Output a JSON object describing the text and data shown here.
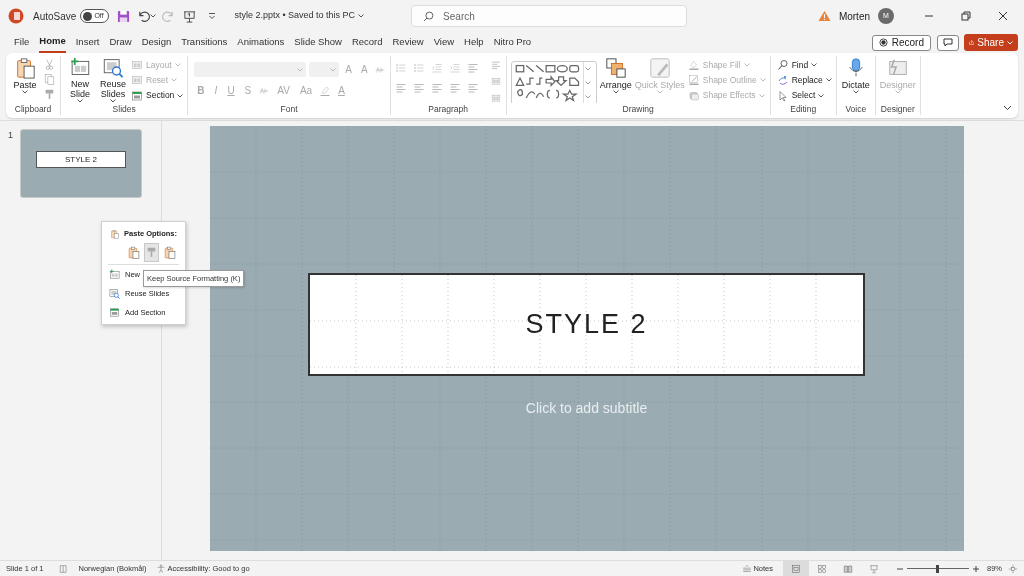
{
  "title_bar": {
    "autosave_label": "AutoSave",
    "autosave": {
      "on": false,
      "label": "Off"
    },
    "document_title": "style 2.pptx • Saved to this PC",
    "search": {
      "placeholder": "Search"
    },
    "user_name": "Morten",
    "avatar_initial": "M"
  },
  "tabs": [
    {
      "label": "File",
      "selected": false
    },
    {
      "label": "Home",
      "selected": true
    },
    {
      "label": "Insert",
      "selected": false
    },
    {
      "label": "Draw",
      "selected": false
    },
    {
      "label": "Design",
      "selected": false
    },
    {
      "label": "Transitions",
      "selected": false
    },
    {
      "label": "Animations",
      "selected": false
    },
    {
      "label": "Slide Show",
      "selected": false
    },
    {
      "label": "Record",
      "selected": false
    },
    {
      "label": "Review",
      "selected": false
    },
    {
      "label": "View",
      "selected": false
    },
    {
      "label": "Help",
      "selected": false
    },
    {
      "label": "Nitro Pro",
      "selected": false
    }
  ],
  "record_button": "Record",
  "share_button": "Share",
  "ribbon": {
    "groups": [
      {
        "title": "Clipboard",
        "items": [
          {
            "kind": "large",
            "label": "Paste",
            "disabled": false
          }
        ]
      },
      {
        "title": "Slides",
        "items": [
          {
            "kind": "large",
            "label": "New Slide",
            "disabled": false
          },
          {
            "kind": "large",
            "label": "Reuse Slides",
            "disabled": false
          },
          {
            "kind": "small",
            "label": "Layout",
            "disabled": true
          },
          {
            "kind": "small",
            "label": "Reset",
            "disabled": true
          },
          {
            "kind": "small",
            "label": "Section",
            "disabled": false
          }
        ]
      },
      {
        "title": "Font",
        "items": [
          {
            "kind": "text",
            "label": "A",
            "disabled": true
          },
          {
            "kind": "text",
            "label": "A",
            "disabled": true
          },
          {
            "kind": "text",
            "label": "B",
            "disabled": true
          },
          {
            "kind": "text",
            "label": "I",
            "disabled": true
          },
          {
            "kind": "text",
            "label": "U",
            "disabled": true
          },
          {
            "kind": "text",
            "label": "S",
            "disabled": true
          },
          {
            "kind": "text",
            "label": "AV",
            "disabled": true
          },
          {
            "kind": "text",
            "label": "Aa",
            "disabled": true
          },
          {
            "kind": "text",
            "label": "A",
            "disabled": true
          }
        ]
      },
      {
        "title": "Paragraph"
      },
      {
        "title": "Drawing",
        "items": [
          {
            "kind": "large",
            "label": "Arrange",
            "disabled": false
          },
          {
            "kind": "large",
            "label": "Quick Styles",
            "disabled": true
          },
          {
            "kind": "small",
            "label": "Shape Fill",
            "disabled": true
          },
          {
            "kind": "small",
            "label": "Shape Outline",
            "disabled": true
          },
          {
            "kind": "small",
            "label": "Shape Effects",
            "disabled": true
          }
        ]
      },
      {
        "title": "Editing",
        "items": [
          {
            "kind": "small",
            "label": "Find",
            "disabled": false
          },
          {
            "kind": "small",
            "label": "Replace",
            "disabled": false
          },
          {
            "kind": "small",
            "label": "Select",
            "disabled": false
          }
        ]
      },
      {
        "title": "Voice",
        "items": [
          {
            "kind": "large",
            "label": "Dictate",
            "disabled": false
          }
        ]
      },
      {
        "title": "Designer",
        "items": [
          {
            "kind": "large",
            "label": "Designer",
            "disabled": true
          }
        ]
      }
    ]
  },
  "slide_panel": {
    "slides": [
      {
        "number": "1",
        "title": "STYLE 2"
      }
    ]
  },
  "slide": {
    "title": "STYLE 2",
    "subtitle_placeholder": "Click to add subtitle"
  },
  "context_menu": {
    "heading": "Paste Options:",
    "paste_options": [
      {
        "selected": false
      },
      {
        "selected": true
      },
      {
        "selected": false
      }
    ],
    "items": [
      "New",
      "Reuse Slides",
      "Add Section"
    ]
  },
  "tooltip": "Keep Source Formatting (K)",
  "status_bar": {
    "slide_count": "Slide 1 of 1",
    "language": "Norwegian (Bokmål)",
    "accessibility": "Accessibility: Good to go",
    "notes": "Notes",
    "views": [
      {
        "selected": true
      },
      {
        "selected": false
      },
      {
        "selected": false
      },
      {
        "selected": false
      }
    ],
    "zoom": {
      "level": 0.5
    },
    "zoom_reading": "89%"
  }
}
